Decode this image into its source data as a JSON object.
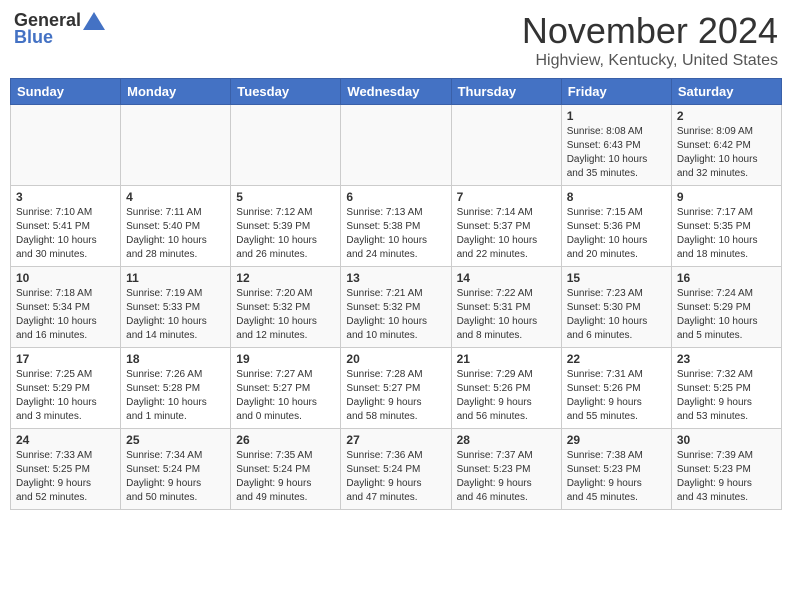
{
  "header": {
    "logo_general": "General",
    "logo_blue": "Blue",
    "month": "November 2024",
    "location": "Highview, Kentucky, United States"
  },
  "weekdays": [
    "Sunday",
    "Monday",
    "Tuesday",
    "Wednesday",
    "Thursday",
    "Friday",
    "Saturday"
  ],
  "weeks": [
    [
      {
        "day": "",
        "info": ""
      },
      {
        "day": "",
        "info": ""
      },
      {
        "day": "",
        "info": ""
      },
      {
        "day": "",
        "info": ""
      },
      {
        "day": "",
        "info": ""
      },
      {
        "day": "1",
        "info": "Sunrise: 8:08 AM\nSunset: 6:43 PM\nDaylight: 10 hours\nand 35 minutes."
      },
      {
        "day": "2",
        "info": "Sunrise: 8:09 AM\nSunset: 6:42 PM\nDaylight: 10 hours\nand 32 minutes."
      }
    ],
    [
      {
        "day": "3",
        "info": "Sunrise: 7:10 AM\nSunset: 5:41 PM\nDaylight: 10 hours\nand 30 minutes."
      },
      {
        "day": "4",
        "info": "Sunrise: 7:11 AM\nSunset: 5:40 PM\nDaylight: 10 hours\nand 28 minutes."
      },
      {
        "day": "5",
        "info": "Sunrise: 7:12 AM\nSunset: 5:39 PM\nDaylight: 10 hours\nand 26 minutes."
      },
      {
        "day": "6",
        "info": "Sunrise: 7:13 AM\nSunset: 5:38 PM\nDaylight: 10 hours\nand 24 minutes."
      },
      {
        "day": "7",
        "info": "Sunrise: 7:14 AM\nSunset: 5:37 PM\nDaylight: 10 hours\nand 22 minutes."
      },
      {
        "day": "8",
        "info": "Sunrise: 7:15 AM\nSunset: 5:36 PM\nDaylight: 10 hours\nand 20 minutes."
      },
      {
        "day": "9",
        "info": "Sunrise: 7:17 AM\nSunset: 5:35 PM\nDaylight: 10 hours\nand 18 minutes."
      }
    ],
    [
      {
        "day": "10",
        "info": "Sunrise: 7:18 AM\nSunset: 5:34 PM\nDaylight: 10 hours\nand 16 minutes."
      },
      {
        "day": "11",
        "info": "Sunrise: 7:19 AM\nSunset: 5:33 PM\nDaylight: 10 hours\nand 14 minutes."
      },
      {
        "day": "12",
        "info": "Sunrise: 7:20 AM\nSunset: 5:32 PM\nDaylight: 10 hours\nand 12 minutes."
      },
      {
        "day": "13",
        "info": "Sunrise: 7:21 AM\nSunset: 5:32 PM\nDaylight: 10 hours\nand 10 minutes."
      },
      {
        "day": "14",
        "info": "Sunrise: 7:22 AM\nSunset: 5:31 PM\nDaylight: 10 hours\nand 8 minutes."
      },
      {
        "day": "15",
        "info": "Sunrise: 7:23 AM\nSunset: 5:30 PM\nDaylight: 10 hours\nand 6 minutes."
      },
      {
        "day": "16",
        "info": "Sunrise: 7:24 AM\nSunset: 5:29 PM\nDaylight: 10 hours\nand 5 minutes."
      }
    ],
    [
      {
        "day": "17",
        "info": "Sunrise: 7:25 AM\nSunset: 5:29 PM\nDaylight: 10 hours\nand 3 minutes."
      },
      {
        "day": "18",
        "info": "Sunrise: 7:26 AM\nSunset: 5:28 PM\nDaylight: 10 hours\nand 1 minute."
      },
      {
        "day": "19",
        "info": "Sunrise: 7:27 AM\nSunset: 5:27 PM\nDaylight: 10 hours\nand 0 minutes."
      },
      {
        "day": "20",
        "info": "Sunrise: 7:28 AM\nSunset: 5:27 PM\nDaylight: 9 hours\nand 58 minutes."
      },
      {
        "day": "21",
        "info": "Sunrise: 7:29 AM\nSunset: 5:26 PM\nDaylight: 9 hours\nand 56 minutes."
      },
      {
        "day": "22",
        "info": "Sunrise: 7:31 AM\nSunset: 5:26 PM\nDaylight: 9 hours\nand 55 minutes."
      },
      {
        "day": "23",
        "info": "Sunrise: 7:32 AM\nSunset: 5:25 PM\nDaylight: 9 hours\nand 53 minutes."
      }
    ],
    [
      {
        "day": "24",
        "info": "Sunrise: 7:33 AM\nSunset: 5:25 PM\nDaylight: 9 hours\nand 52 minutes."
      },
      {
        "day": "25",
        "info": "Sunrise: 7:34 AM\nSunset: 5:24 PM\nDaylight: 9 hours\nand 50 minutes."
      },
      {
        "day": "26",
        "info": "Sunrise: 7:35 AM\nSunset: 5:24 PM\nDaylight: 9 hours\nand 49 minutes."
      },
      {
        "day": "27",
        "info": "Sunrise: 7:36 AM\nSunset: 5:24 PM\nDaylight: 9 hours\nand 47 minutes."
      },
      {
        "day": "28",
        "info": "Sunrise: 7:37 AM\nSunset: 5:23 PM\nDaylight: 9 hours\nand 46 minutes."
      },
      {
        "day": "29",
        "info": "Sunrise: 7:38 AM\nSunset: 5:23 PM\nDaylight: 9 hours\nand 45 minutes."
      },
      {
        "day": "30",
        "info": "Sunrise: 7:39 AM\nSunset: 5:23 PM\nDaylight: 9 hours\nand 43 minutes."
      }
    ]
  ]
}
